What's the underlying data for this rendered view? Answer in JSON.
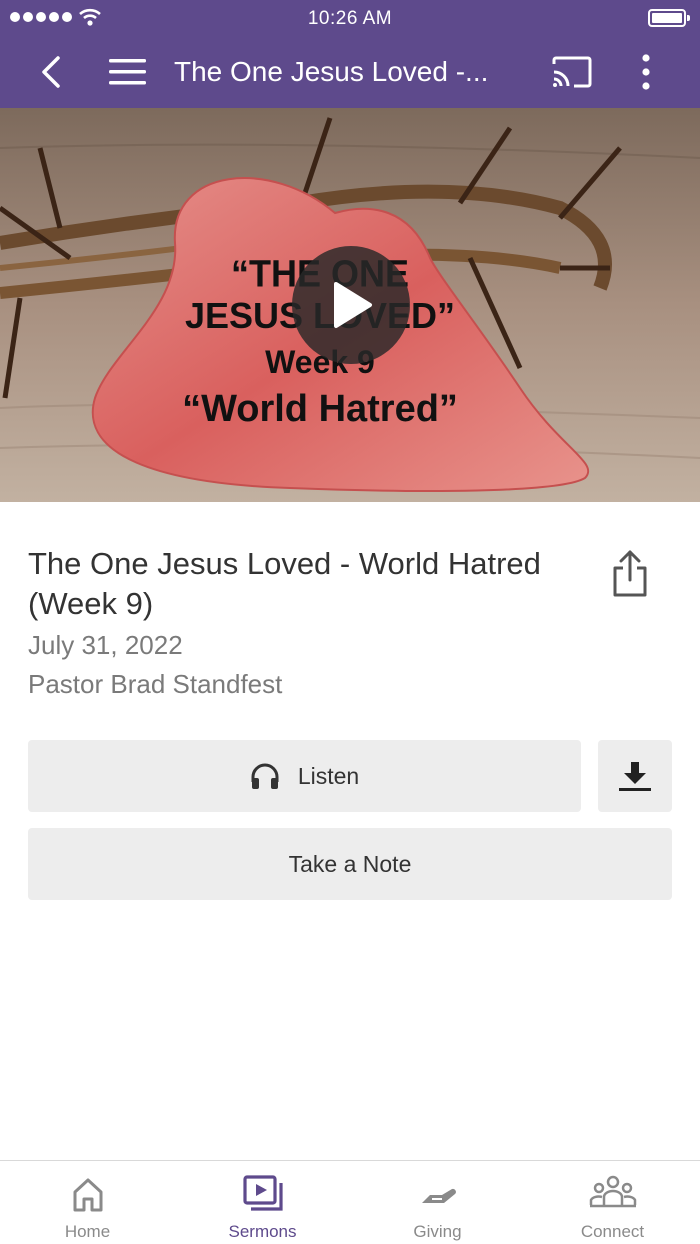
{
  "status_bar": {
    "time": "10:26 AM"
  },
  "nav": {
    "title": "The One Jesus Loved -..."
  },
  "hero": {
    "line1": "“THE ONE",
    "line2": "JESUS LOVED”",
    "line3": "Week 9",
    "line4": "“World Hatred”"
  },
  "sermon": {
    "title": "The One Jesus Loved - World Hatred (Week 9)",
    "date": "July 31, 2022",
    "speaker": "Pastor Brad Standfest"
  },
  "actions": {
    "listen_label": "Listen",
    "note_label": "Take a Note"
  },
  "tabs": [
    {
      "label": "Home",
      "icon": "home-icon",
      "active": false
    },
    {
      "label": "Sermons",
      "icon": "sermons-icon",
      "active": true
    },
    {
      "label": "Giving",
      "icon": "giving-icon",
      "active": false
    },
    {
      "label": "Connect",
      "icon": "connect-icon",
      "active": false
    }
  ],
  "colors": {
    "brand": "#5e4a8c",
    "button_bg": "#ededed"
  }
}
